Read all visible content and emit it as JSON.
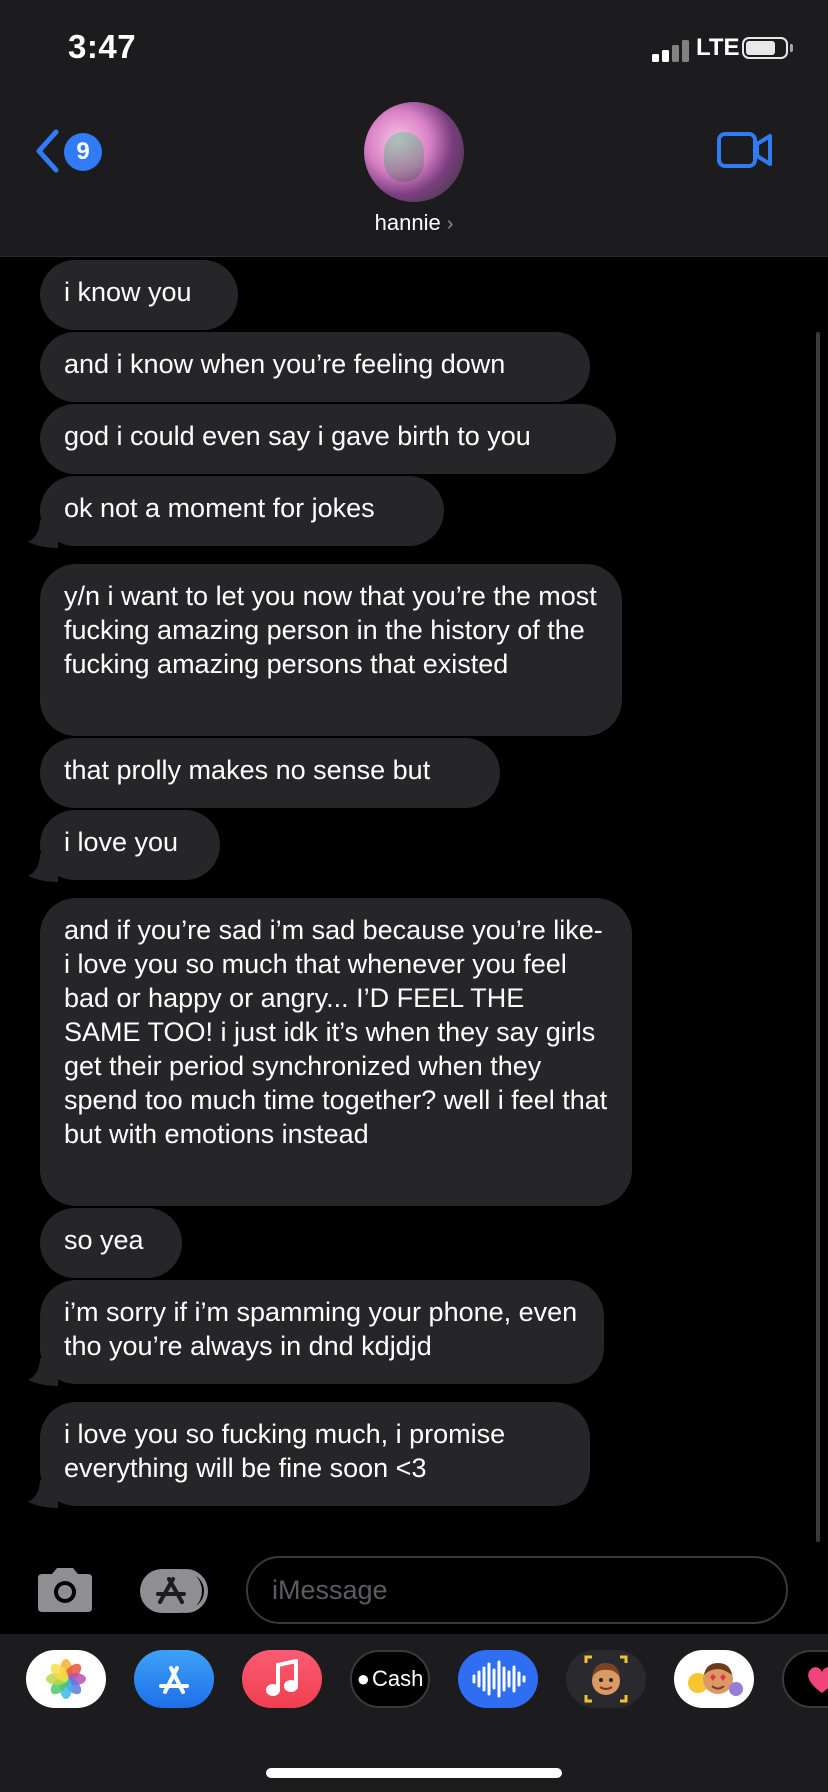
{
  "status_bar": {
    "time": "3:47",
    "network": "LTE",
    "battery_level": 0.75
  },
  "header": {
    "back_badge_count": "9",
    "contact_name": "hannie",
    "contact_chevron": "›",
    "icons": {
      "back": "chevron-left-icon",
      "video": "video-camera-icon"
    }
  },
  "messages": [
    {
      "text": "i know you",
      "tail": false
    },
    {
      "text": "and i know when you’re feeling down",
      "tail": false
    },
    {
      "text": "god i could even say i gave birth to you",
      "tail": false
    },
    {
      "text": "ok not a moment for jokes",
      "tail": true
    },
    {
      "text": "y/n i want to let you now that you’re the most fucking amazing person in the history of the fucking amazing persons that existed",
      "tail": false
    },
    {
      "text": "that prolly makes no sense but",
      "tail": false
    },
    {
      "text": "i love you",
      "tail": true
    },
    {
      "text": "and if you’re sad i’m sad because you’re like- i love you so much that whenever you feel bad or happy or angry... I’D FEEL THE SAME TOO! i just idk it’s when they say girls get their period synchronized when they spend too much time together? well i feel that but with emotions instead",
      "tail": false
    },
    {
      "text": "so yea",
      "tail": false
    },
    {
      "text": "i’m sorry if i’m spamming your phone, even tho you’re always in dnd kdjdjd",
      "tail": true
    },
    {
      "text": "i love you so fucking much, i promise everything will be fine soon <3",
      "tail": true
    }
  ],
  "input": {
    "placeholder": "iMessage"
  },
  "app_drawer": {
    "apps": [
      {
        "name": "photos-app-icon"
      },
      {
        "name": "app-store-icon"
      },
      {
        "name": "music-app-icon"
      },
      {
        "name": "apple-cash-icon",
        "label": "Cash"
      },
      {
        "name": "audio-message-icon"
      },
      {
        "name": "memoji-icon"
      },
      {
        "name": "animoji-stickers-icon"
      },
      {
        "name": "digital-touch-icon"
      }
    ]
  },
  "colors": {
    "accent": "#2f7cf6",
    "bubble": "#262629",
    "header": "#1c1c1e",
    "background": "#000000"
  }
}
